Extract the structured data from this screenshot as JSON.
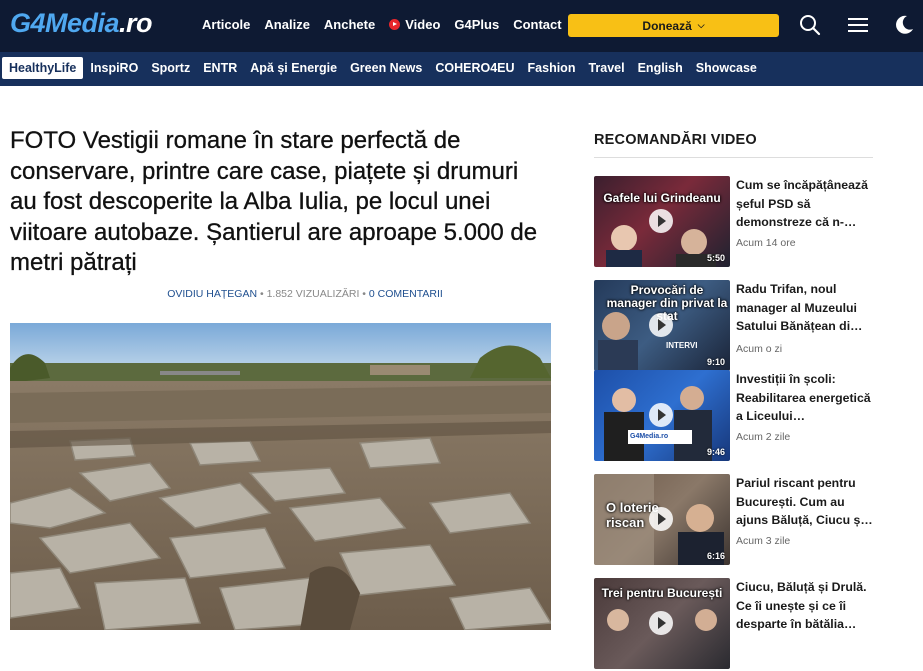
{
  "header": {
    "logo_main": "G4Media",
    "logo_suffix": ".ro",
    "nav": [
      "Articole",
      "Analize",
      "Anchete",
      "Video",
      "G4Plus",
      "Contact"
    ],
    "donate_label": "Donează",
    "colors": {
      "bg": "#0e1a33",
      "donate": "#f8c015",
      "logo": "#4fa8f0"
    }
  },
  "subnav": {
    "items": [
      "HealthyLife",
      "InspiRO",
      "Sportz",
      "ENTR",
      "Apă și Energie",
      "Green News",
      "COHERO4EU",
      "Fashion",
      "Travel",
      "English",
      "Showcase"
    ],
    "active": "HealthyLife",
    "color": "#17305c"
  },
  "article": {
    "title": "FOTO Vestigii romane în stare perfectă de conservare, printre care case, piațete și drumuri au fost descoperite la Alba Iulia, pe locul unei viitoare autobaze. Șantierul are aproape 5.000 de metri pătrați",
    "author": "OVIDIU HAȚEGAN",
    "views": "1.852 VIZUALIZĂRI",
    "comments": "0 COMENTARII",
    "separator": "•"
  },
  "sidebar": {
    "title": "RECOMANDĂRI VIDEO",
    "videos": [
      {
        "title": "Cum se încăpățânează șeful PSD să demonstreze că n-…",
        "time": "Acum 14 ore",
        "duration": "5:50",
        "caption": "Gafele lui Grindeanu"
      },
      {
        "title": "Radu Trifan, noul manager al Muzeului Satului Bănățean di…",
        "time": "Acum o zi",
        "duration": "9:10",
        "caption": "Provocări de manager din privat la stat",
        "caption2": "INTERVI"
      },
      {
        "title": "Investiții în școli: Reabilitarea energetică a Liceului…",
        "time": "Acum 2 zile",
        "duration": "9:46",
        "caption": "G4Media.ro"
      },
      {
        "title": "Pariul riscant pentru București. Cum au ajuns Băluță, Ciucu ș…",
        "time": "Acum 3 zile",
        "duration": "6:16",
        "caption": "O loterie riscan"
      },
      {
        "title": "Ciucu, Băluță și Drulă. Ce îi unește și ce îi desparte în bătălia…",
        "time": "",
        "duration": "",
        "caption": "Trei pentru București"
      }
    ]
  }
}
